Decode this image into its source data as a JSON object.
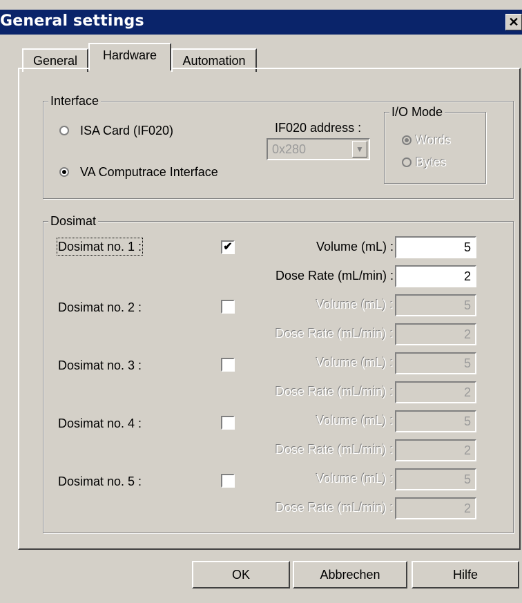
{
  "window": {
    "title": "General settings",
    "close_label": "✕"
  },
  "tabs": [
    {
      "label": "General",
      "active": false
    },
    {
      "label": "Hardware",
      "active": true
    },
    {
      "label": "Automation",
      "active": false
    }
  ],
  "interface": {
    "group_label": "Interface",
    "options": [
      {
        "label": "ISA Card (IF020)",
        "selected": false
      },
      {
        "label": "VA Computrace Interface",
        "selected": true
      }
    ],
    "address_label": "IF020 address :",
    "address_value": "0x280",
    "io_mode": {
      "group_label": "I/O Mode",
      "options": [
        {
          "label": "Words",
          "selected": true
        },
        {
          "label": "Bytes",
          "selected": false
        }
      ]
    }
  },
  "dosimat": {
    "group_label": "Dosimat",
    "volume_label": "Volume (mL) :",
    "dose_rate_label": "Dose Rate (mL/min) :",
    "items": [
      {
        "label": "Dosimat no. 1 :",
        "checked": true,
        "volume": "5",
        "dose_rate": "2"
      },
      {
        "label": "Dosimat no. 2 :",
        "checked": false,
        "volume": "5",
        "dose_rate": "2"
      },
      {
        "label": "Dosimat no. 3 :",
        "checked": false,
        "volume": "5",
        "dose_rate": "2"
      },
      {
        "label": "Dosimat no. 4 :",
        "checked": false,
        "volume": "5",
        "dose_rate": "2"
      },
      {
        "label": "Dosimat no. 5 :",
        "checked": false,
        "volume": "5",
        "dose_rate": "2"
      }
    ]
  },
  "buttons": {
    "ok": "OK",
    "cancel": "Abbrechen",
    "help": "Hilfe"
  },
  "colors": {
    "titlebar": "#0a246a",
    "face": "#d4d0c8"
  },
  "icons": {
    "close": "close-icon",
    "checkmark": "checkmark-icon",
    "dropdown": "chevron-down-icon"
  }
}
